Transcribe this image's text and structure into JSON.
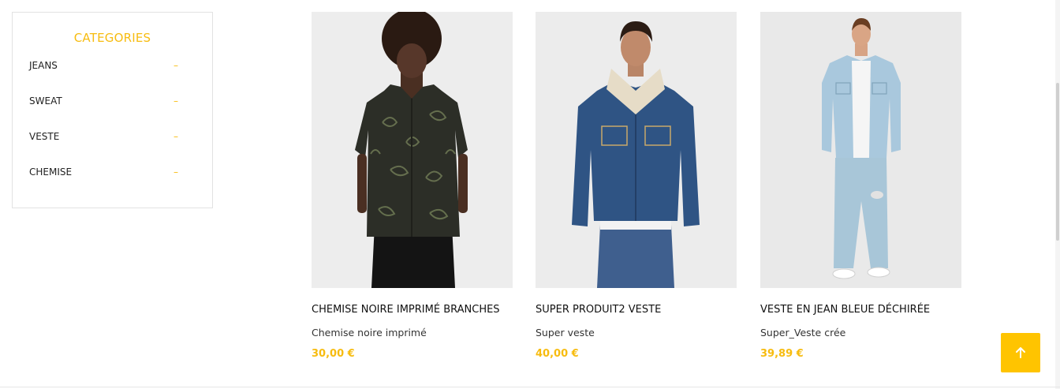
{
  "sidebar": {
    "title": "CATEGORIES",
    "items": [
      {
        "label": "JEANS",
        "toggle": "–"
      },
      {
        "label": "SWEAT",
        "toggle": "–"
      },
      {
        "label": "VESTE",
        "toggle": "–"
      },
      {
        "label": "CHEMISE",
        "toggle": "–"
      }
    ]
  },
  "products": [
    {
      "name": "CHEMISE NOIRE IMPRIMÉ BRANCHES",
      "description": "Chemise noire imprimé",
      "price": "30,00 €"
    },
    {
      "name": "SUPER PRODUIT2 VESTE",
      "description": "Super veste",
      "price": "40,00 €"
    },
    {
      "name": "VESTE EN JEAN BLEUE DÉCHIRÉE",
      "description": "Super_Veste crée",
      "price": "39,89 €"
    }
  ],
  "colors": {
    "accent": "#f7bc10",
    "scroll_button": "#ffc400"
  },
  "icons": {
    "scroll_top": "arrow-up-icon"
  }
}
